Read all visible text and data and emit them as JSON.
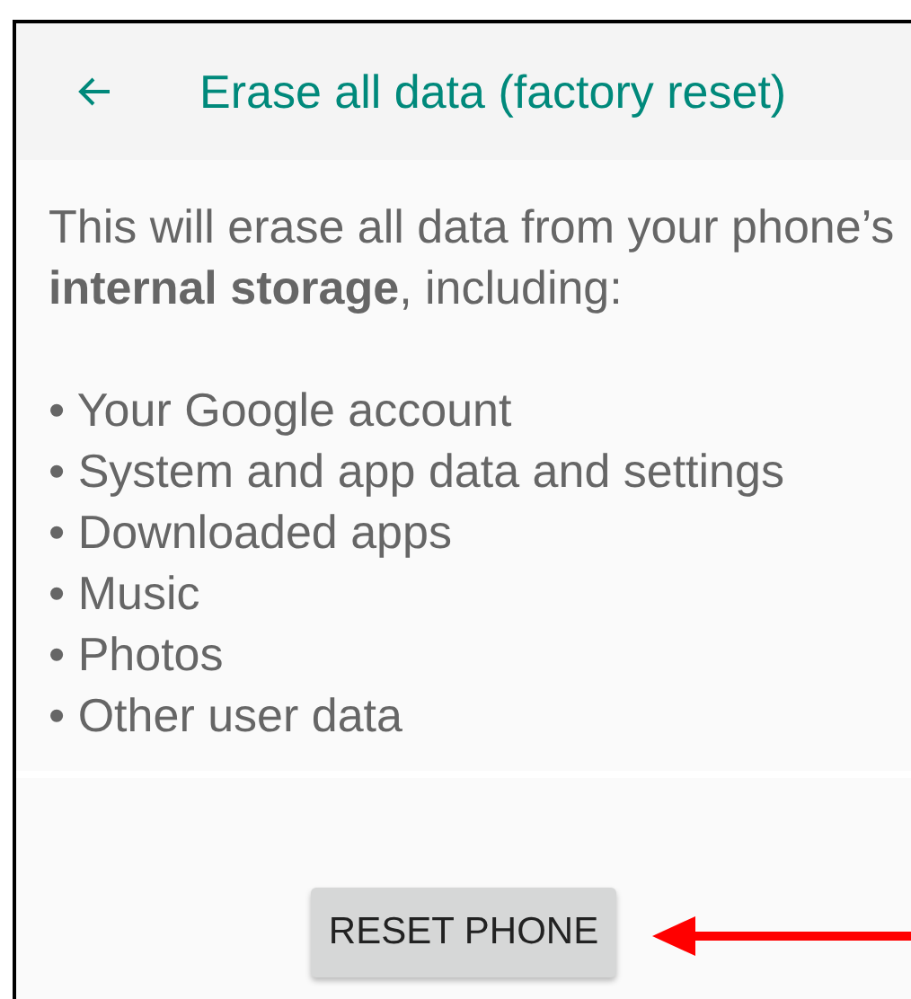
{
  "header": {
    "title": "Erase all data (factory reset)"
  },
  "intro": "This will erase all data from your phone’s **internal storage**, including:",
  "items": [
    "• Your Google account",
    "• System and app data and settings",
    "• Downloaded apps",
    "• Music",
    "• Photos",
    "• Other user data"
  ],
  "button": {
    "label": "RESET PHONE"
  }
}
